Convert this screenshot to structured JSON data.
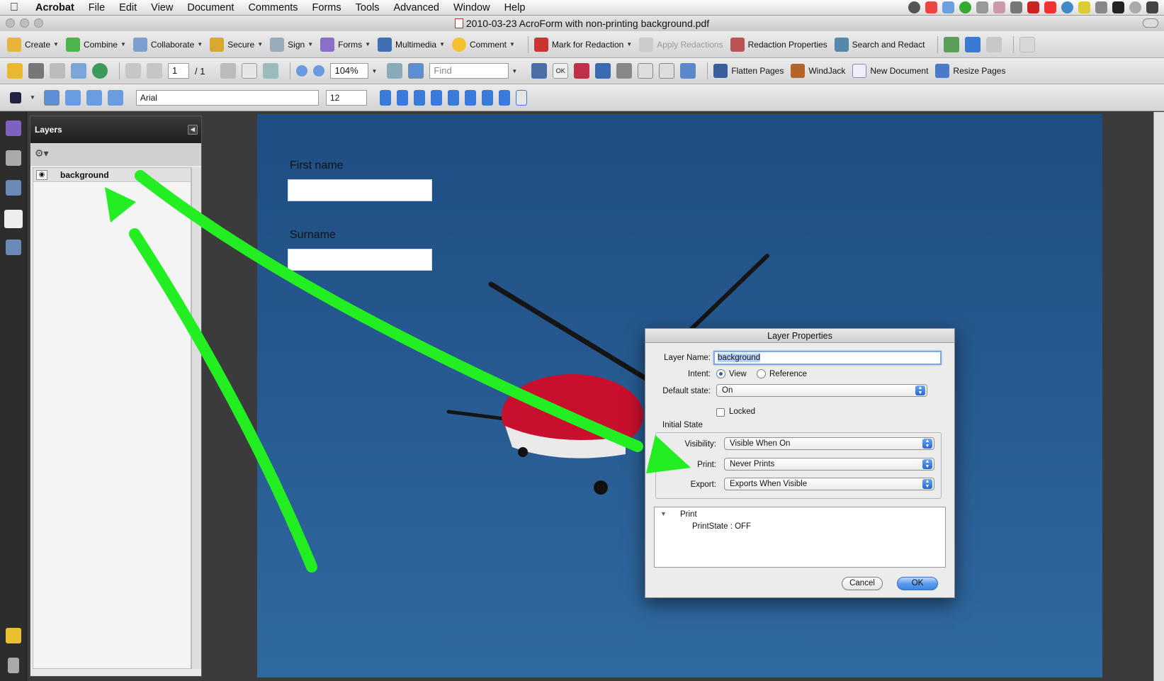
{
  "menubar": {
    "app": "Acrobat",
    "items": [
      "File",
      "Edit",
      "View",
      "Document",
      "Comments",
      "Forms",
      "Tools",
      "Advanced",
      "Window",
      "Help"
    ]
  },
  "window": {
    "title": "2010-03-23 AcroForm with non-printing background.pdf"
  },
  "toolbar1": {
    "create": "Create",
    "combine": "Combine",
    "collaborate": "Collaborate",
    "secure": "Secure",
    "sign": "Sign",
    "forms": "Forms",
    "multimedia": "Multimedia",
    "comment": "Comment",
    "mark_redaction": "Mark for Redaction",
    "apply_redactions": "Apply Redactions",
    "redaction_properties": "Redaction Properties",
    "search_redact": "Search and Redact"
  },
  "toolbar2": {
    "page_current": "1",
    "page_total": "/ 1",
    "zoom": "104%",
    "find_placeholder": "Find",
    "ok_tool": "OK",
    "flatten": "Flatten Pages",
    "windjack": "WindJack",
    "new_document": "New Document",
    "resize_pages": "Resize Pages"
  },
  "toolbar3": {
    "font": "Arial",
    "size": "12"
  },
  "layers_panel": {
    "title": "Layers",
    "layers": [
      {
        "name": "background",
        "visible": true
      }
    ]
  },
  "document": {
    "fields": [
      {
        "label": "First name",
        "value": ""
      },
      {
        "label": "Surname",
        "value": ""
      }
    ]
  },
  "dialog": {
    "title": "Layer Properties",
    "layer_name_label": "Layer Name:",
    "layer_name": "background",
    "intent_label": "Intent:",
    "intent_options": [
      "View",
      "Reference"
    ],
    "intent_selected": "View",
    "default_state_label": "Default state:",
    "default_state": "On",
    "locked_label": "Locked",
    "locked": false,
    "initial_state_label": "Initial State",
    "visibility_label": "Visibility:",
    "visibility": "Visible When On",
    "print_label": "Print:",
    "print": "Never Prints",
    "export_label": "Export:",
    "export": "Exports When Visible",
    "info_section": "Print",
    "info_detail": "PrintState : OFF",
    "cancel": "Cancel",
    "ok": "OK"
  },
  "colors": {
    "page_sky": "#2a5d94",
    "annotation_arrow": "#22ee22",
    "dialog_default_button": "#4a8ee8"
  }
}
